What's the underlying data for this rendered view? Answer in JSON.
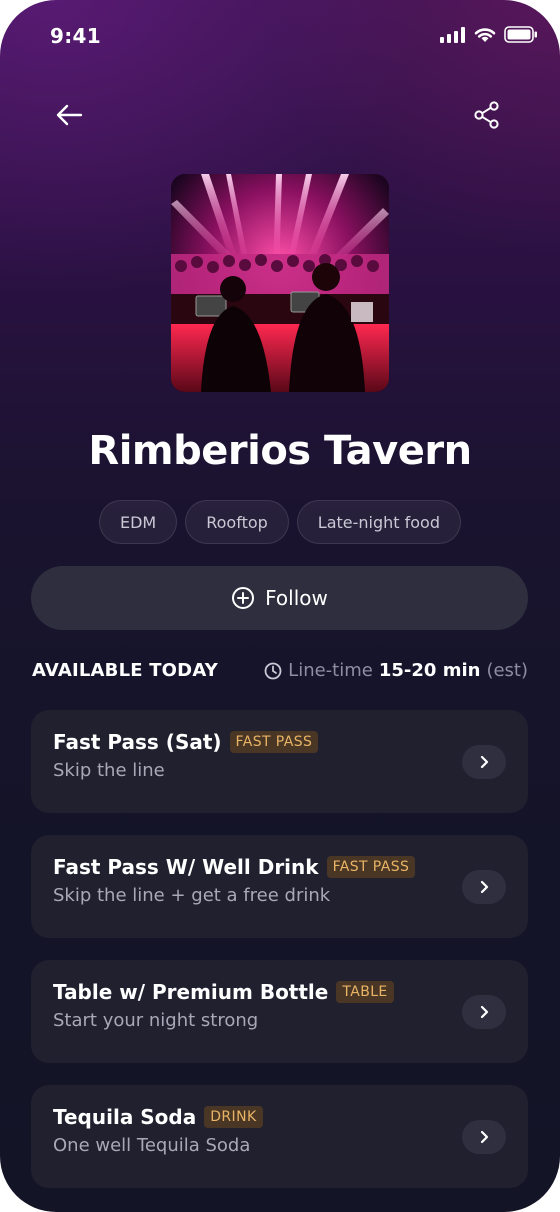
{
  "status_bar": {
    "time": "9:41"
  },
  "nav": {
    "back_icon": "arrow-left-icon",
    "share_icon": "share-icon"
  },
  "venue": {
    "name": "Rimberios Tavern",
    "tags": [
      "EDM",
      "Rooftop",
      "Late-night food"
    ]
  },
  "follow": {
    "label": "Follow",
    "icon": "plus-circle-icon"
  },
  "available": {
    "title": "AVAILABLE TODAY",
    "line_time_label": "Line-time",
    "line_time_value": "15-20 min",
    "line_time_note": "(est)"
  },
  "offers": [
    {
      "title": "Fast Pass (Sat)",
      "badge": "FAST PASS",
      "subtitle": "Skip the line"
    },
    {
      "title": "Fast Pass W/ Well Drink",
      "badge": "FAST PASS",
      "subtitle": "Skip the line + get a free drink"
    },
    {
      "title": "Table w/ Premium Bottle",
      "badge": "TABLE",
      "subtitle": "Start your night strong"
    },
    {
      "title": "Tequila Soda",
      "badge": "DRINK",
      "subtitle": "One well Tequila Soda"
    }
  ],
  "colors": {
    "badge_bg": "#4a3624",
    "badge_text": "#e9b466",
    "card_bg": "#20202f"
  }
}
